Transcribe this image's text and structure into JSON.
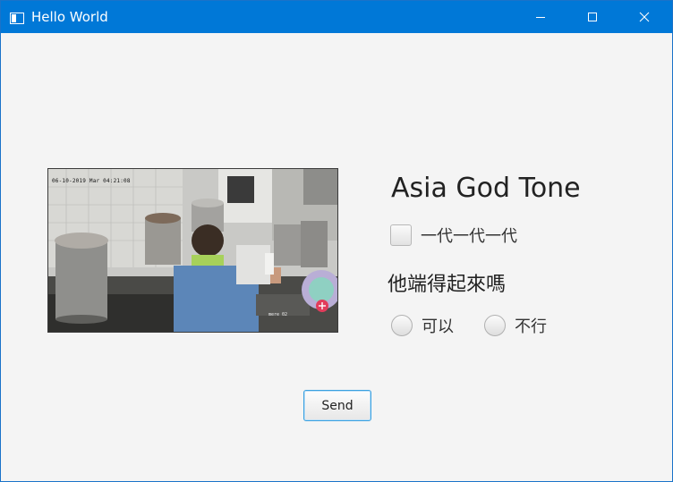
{
  "window": {
    "title": "Hello World",
    "icon": "app-window-icon",
    "controls": [
      "minimize-icon",
      "maximize-icon",
      "close-icon"
    ],
    "colors": {
      "titlebar": "#0078d7",
      "background": "#f4f4f4",
      "accent": "#39a0e0"
    }
  },
  "video": {
    "timestamp": "06-10-2019 Mar 04:21:08",
    "caption": "mere 02"
  },
  "form": {
    "heading": "Asia God Tone",
    "checkbox": {
      "label": "一代一代一代",
      "checked": false
    },
    "question": "他端得起來嗎",
    "radios": [
      {
        "label": "可以",
        "selected": false
      },
      {
        "label": "不行",
        "selected": false
      }
    ],
    "send_label": "Send"
  }
}
